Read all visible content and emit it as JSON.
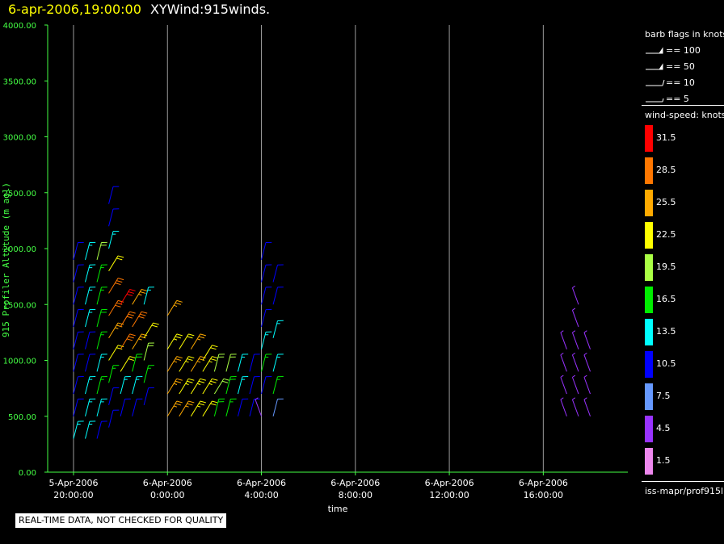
{
  "header": {
    "datetime": "6-apr-2006,19:00:00",
    "product": "XYWind:915winds."
  },
  "chart_data": {
    "type": "scatter",
    "ylabel": "915 Profiler Altitude (m agl)",
    "xlabel": "time",
    "ylim": [
      0,
      4000
    ],
    "y_ticks": [
      "0.00",
      "500.00",
      "1000.00",
      "1500.00",
      "2000.00",
      "2500.00",
      "3000.00",
      "3500.00",
      "4000.00"
    ],
    "x_ticks": [
      {
        "date": "5-Apr-2006",
        "time": "20:00:00"
      },
      {
        "date": "6-Apr-2006",
        "time": "0:00:00"
      },
      {
        "date": "6-Apr-2006",
        "time": "4:00:00"
      },
      {
        "date": "6-Apr-2006",
        "time": "8:00:00"
      },
      {
        "date": "6-Apr-2006",
        "time": "12:00:00"
      },
      {
        "date": "6-Apr-2006",
        "time": "16:00:00"
      }
    ],
    "x_range_hours": [
      -1.1,
      23.6
    ],
    "axis_color": "#44ff44",
    "grid": true,
    "profiles": [
      {
        "t": 0.0,
        "heights": [
          300,
          500,
          700,
          900,
          1100,
          1300,
          1500,
          1700,
          1900
        ],
        "speeds": [
          14,
          12,
          11,
          11,
          11,
          11,
          11,
          10,
          11
        ]
      },
      {
        "t": 0.5,
        "heights": [
          300,
          500,
          700,
          900,
          1100,
          1300,
          1500,
          1700,
          1900
        ],
        "speeds": [
          13,
          14,
          14,
          12,
          12,
          13,
          13,
          14,
          15
        ]
      },
      {
        "t": 1.0,
        "heights": [
          300,
          500,
          700,
          900,
          1100,
          1300,
          1500,
          1700,
          1900
        ],
        "speeds": [
          12,
          14,
          16,
          15,
          16,
          18,
          16,
          17,
          19
        ]
      },
      {
        "t": 1.5,
        "heights": [
          400,
          600,
          800,
          1000,
          1200,
          1400,
          1600,
          1800,
          2000,
          2200,
          2400
        ],
        "speeds": [
          10,
          12,
          17,
          22,
          25,
          28,
          30,
          22,
          15,
          11,
          10
        ]
      },
      {
        "t": 2.0,
        "heights": [
          500,
          700,
          900,
          1100,
          1300,
          1500
        ],
        "speeds": [
          10,
          14,
          22,
          28,
          30,
          32
        ]
      },
      {
        "t": 2.5,
        "heights": [
          500,
          700,
          900,
          1100,
          1300,
          1500
        ],
        "speeds": [
          10,
          13,
          18,
          26,
          30,
          27
        ]
      },
      {
        "t": 3.0,
        "heights": [
          600,
          800,
          1000,
          1200,
          1500
        ],
        "speeds": [
          10,
          16,
          20,
          22,
          14
        ]
      },
      {
        "t": 4.0,
        "heights": [
          500,
          700,
          900,
          1100,
          1400
        ],
        "speeds": [
          26,
          26,
          25,
          24,
          26
        ]
      },
      {
        "t": 4.5,
        "heights": [
          500,
          700,
          900,
          1100
        ],
        "speeds": [
          25,
          24,
          24,
          22
        ]
      },
      {
        "t": 5.0,
        "heights": [
          500,
          700,
          900,
          1100
        ],
        "speeds": [
          24,
          24,
          26,
          25
        ]
      },
      {
        "t": 5.5,
        "heights": [
          500,
          700,
          900,
          1000
        ],
        "speeds": [
          22,
          24,
          23,
          22
        ]
      },
      {
        "t": 6.0,
        "heights": [
          500,
          700,
          900
        ],
        "speeds": [
          18,
          21,
          20
        ]
      },
      {
        "t": 6.5,
        "heights": [
          500,
          700,
          900
        ],
        "speeds": [
          16,
          18,
          20
        ]
      },
      {
        "t": 7.0,
        "heights": [
          500,
          700,
          900
        ],
        "speeds": [
          12,
          14,
          15
        ]
      },
      {
        "t": 7.5,
        "heights": [
          500,
          700,
          900
        ],
        "speeds": [
          10,
          11,
          12
        ]
      },
      {
        "t": 8.0,
        "heights": [
          500,
          700,
          900,
          1100,
          1300,
          1500,
          1700,
          1900
        ],
        "speeds": [
          6,
          11,
          16,
          13,
          11,
          10,
          11,
          10
        ]
      },
      {
        "t": 8.5,
        "heights": [
          500,
          700,
          900,
          1200,
          1500,
          1700
        ],
        "speeds": [
          9,
          16,
          15,
          13,
          10,
          10
        ]
      },
      {
        "t": 21.0,
        "heights": [
          500,
          700,
          900,
          1100
        ],
        "speeds": [
          6,
          5,
          6,
          5
        ]
      },
      {
        "t": 21.5,
        "heights": [
          500,
          700,
          900,
          1100,
          1300,
          1500
        ],
        "speeds": [
          5,
          6,
          5,
          6,
          5,
          6
        ]
      },
      {
        "t": 22.0,
        "heights": [
          500,
          700,
          900,
          1100
        ],
        "speeds": [
          6,
          5,
          5,
          6
        ]
      }
    ]
  },
  "legend": {
    "barb_title": "barb flags in knots",
    "barbs": [
      {
        "label": "== 100",
        "kind": "pennant"
      },
      {
        "label": "== 50",
        "kind": "pennant"
      },
      {
        "label": "== 10",
        "kind": "full"
      },
      {
        "label": "== 5",
        "kind": "half"
      }
    ],
    "speed_title": "wind-speed: knots",
    "scale": [
      {
        "label": "31.5",
        "color": "#ff0000"
      },
      {
        "label": "28.5",
        "color": "#ff7700"
      },
      {
        "label": "25.5",
        "color": "#ffaa00"
      },
      {
        "label": "22.5",
        "color": "#ffff00"
      },
      {
        "label": "19.5",
        "color": "#aaff44"
      },
      {
        "label": "16.5",
        "color": "#00ee00"
      },
      {
        "label": "13.5",
        "color": "#00ffff"
      },
      {
        "label": "10.5",
        "color": "#0000ff"
      },
      {
        "label": "7.5",
        "color": "#6699ff"
      },
      {
        "label": "4.5",
        "color": "#9933ff"
      },
      {
        "label": "1.5",
        "color": "#ee88ee"
      }
    ],
    "source": "iss-mapr/prof915l"
  },
  "disclaimer": "REAL-TIME DATA, NOT CHECKED FOR QUALITY"
}
